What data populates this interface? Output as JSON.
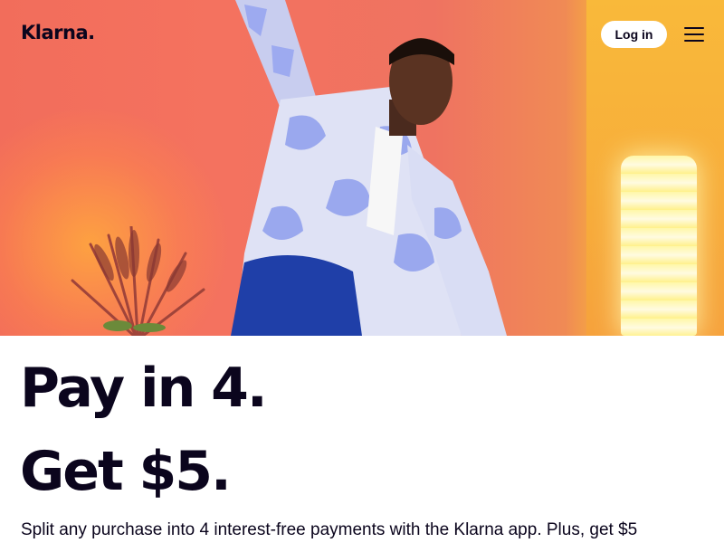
{
  "header": {
    "logo_text": "Klarna.",
    "login_label": "Log in",
    "menu_icon": "hamburger-menu-icon"
  },
  "hero": {
    "image_subject": "man-dancing-photo",
    "colors": {
      "background_coral": "#f26d5b",
      "wall_yellow": "#f7b23a",
      "shirt_lavender": "#a9b6ee",
      "pants_blue": "#1f3fa8"
    }
  },
  "main": {
    "headline_line1": "Pay in 4.",
    "headline_line2": "Get $5.",
    "description": "Split any purchase into 4 interest-free payments with the Klarna app. Plus, get $5"
  }
}
